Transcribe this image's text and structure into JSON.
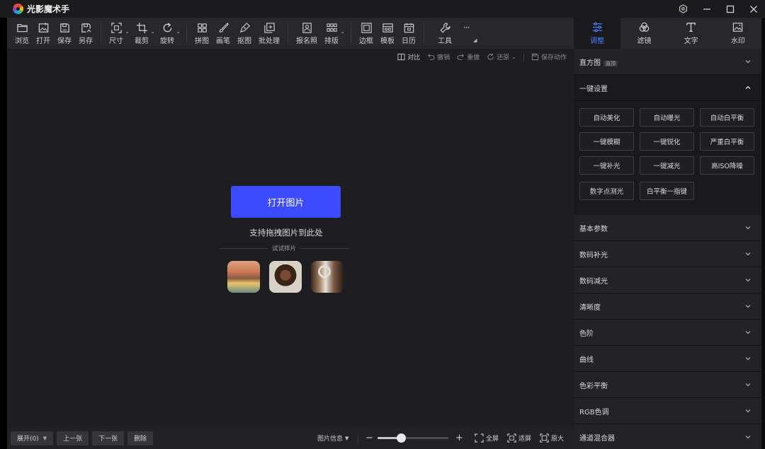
{
  "app": {
    "title": "光影魔术手"
  },
  "window_controls": [
    {
      "name": "settings-icon",
      "glyph": "⚙"
    },
    {
      "name": "minimize-icon",
      "glyph": "—"
    },
    {
      "name": "maximize-icon",
      "glyph": "☐"
    },
    {
      "name": "close-icon",
      "glyph": "✕"
    }
  ],
  "toolbar": {
    "browse": "浏览",
    "open": "打开",
    "save": "保存",
    "save_as": "另存",
    "size": "尺寸",
    "crop": "裁剪",
    "rotate": "旋转",
    "collage": "拼图",
    "brush": "画笔",
    "cutout": "抠图",
    "batch": "批处理",
    "id_photo": "报名照",
    "layout": "排版",
    "border": "边框",
    "template": "模板",
    "calendar": "日历",
    "tools": "工具",
    "more": "···"
  },
  "right_tabs": [
    {
      "label": "调整",
      "icon": "sliders-icon",
      "active": true
    },
    {
      "label": "滤镜",
      "icon": "filter-icon",
      "active": false
    },
    {
      "label": "文字",
      "icon": "text-icon",
      "active": false
    },
    {
      "label": "水印",
      "icon": "watermark-icon",
      "active": false
    }
  ],
  "subbar": {
    "compare": "对比",
    "undo": "撤销",
    "redo": "重做",
    "restore": "还原",
    "save_action": "保存动作"
  },
  "canvas": {
    "open_button": "打开图片",
    "drag_hint": "支持拖拽图片到此处",
    "samples_label": "试试样片"
  },
  "bottom": {
    "expand": "展开(0)",
    "prev": "上一张",
    "next": "下一张",
    "delete": "删除",
    "image_info": "图片信息",
    "zoom_minus": "−",
    "zoom_plus": "+",
    "zoom_level": 0.33,
    "fullscreen": "全屏",
    "fit": "适屏",
    "original": "原大"
  },
  "panel": {
    "histogram": "直方图",
    "histogram_badge": "直顶",
    "one_click": "一键设置",
    "presets": [
      "自动美化",
      "自动曝光",
      "自动白平衡",
      "一键模糊",
      "一键锐化",
      "严重白平衡",
      "一键补光",
      "一键减光",
      "高ISO降噪"
    ],
    "presets_row2": [
      "数字点测光",
      "白平衡一指键"
    ],
    "sections": [
      "基本参数",
      "数码补光",
      "数码减光",
      "清晰度",
      "色阶",
      "曲线",
      "色彩平衡",
      "RGB色调",
      "通道混合器"
    ]
  },
  "colors": {
    "accent": "#3d4bff",
    "tab_active": "#4a7dff",
    "background": "#1e1e22"
  }
}
